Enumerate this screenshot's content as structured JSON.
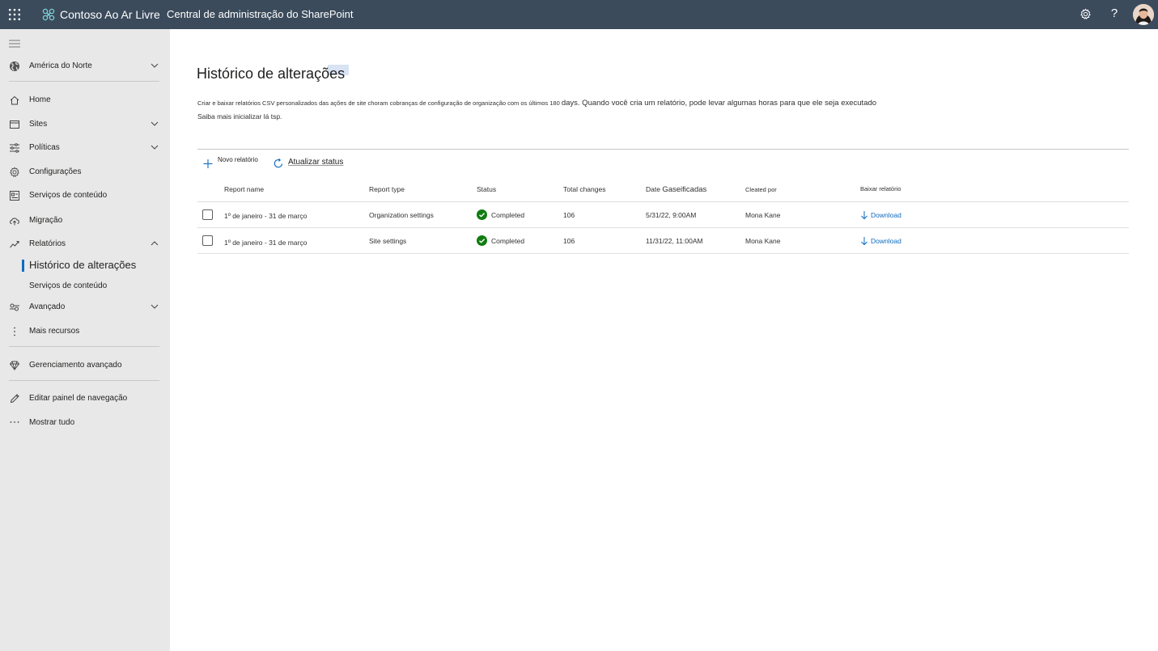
{
  "topbar": {
    "org_name": "Contoso Ao Ar Livre",
    "app_name": "Central de administração do SharePoint",
    "help_label": "?"
  },
  "nav": {
    "region": "América do Norte",
    "items": [
      {
        "label": "Home",
        "icon": "home-icon"
      },
      {
        "label": "Sites",
        "icon": "sites-icon"
      },
      {
        "label": "Políticas",
        "icon": "policies-icon"
      },
      {
        "label": "Configurações",
        "icon": "settings-icon"
      },
      {
        "label": "Serviços de conteúdo",
        "icon": "content-services-icon"
      },
      {
        "label": "Migração",
        "icon": "migration-icon"
      },
      {
        "label": "Relatórios",
        "icon": "reports-icon"
      },
      {
        "label": "Histórico de alterações"
      },
      {
        "label": "Serviços de conteúdo"
      },
      {
        "label": "Avançado",
        "icon": "advanced-icon"
      },
      {
        "label": "Mais recursos",
        "icon": "more-resources-icon"
      },
      {
        "label": "Gerenciamento avançado",
        "icon": "diamond-icon"
      },
      {
        "label": "Editar painel de navegação",
        "icon": "edit-icon"
      },
      {
        "label": "Mostrar tudo",
        "icon": "ellipsis-icon"
      }
    ]
  },
  "main": {
    "title": "Histórico de alterações",
    "description_part1": "Criar e baixar relatórios CSV personalizados das ações de site choram cobranças de configuração de organização com os últimos 180 ",
    "description_days": "days.",
    "description_part2": " Quando você cria um relatório, pode levar algumas horas para que ele seja executado",
    "learn_more": "Saiba mais inicializar lá tsp.",
    "commands": {
      "new_report": "Novo relatório",
      "refresh_status": "Atualizar status"
    },
    "table": {
      "headers": {
        "report_name": "Report name",
        "report_type": "Report type",
        "status": "Status",
        "total_changes": "Total changes",
        "date_prefix": "Date",
        "date_suffix": "Gaseificadas",
        "created_by": "Cleated por",
        "download": "Baixar relatório"
      },
      "rows": [
        {
          "name": "1º de janeiro - 31 de março",
          "type": "Organization settings",
          "status": "Completed",
          "total": "106",
          "date": "5/31/22, 9:00AM",
          "created_by": "Mona Kane",
          "download": "Download"
        },
        {
          "name": "1º de janeiro - 31 de março",
          "type": "Site settings",
          "status": "Completed",
          "total": "106",
          "date": "11/31/22, 11:00AM",
          "created_by": "Mona Kane",
          "download": "Download"
        }
      ]
    }
  },
  "colors": {
    "topbar": "#3b4b5c",
    "nav_bg": "#e8e8e8",
    "accent": "#0f6cbd",
    "success": "#107c10"
  }
}
